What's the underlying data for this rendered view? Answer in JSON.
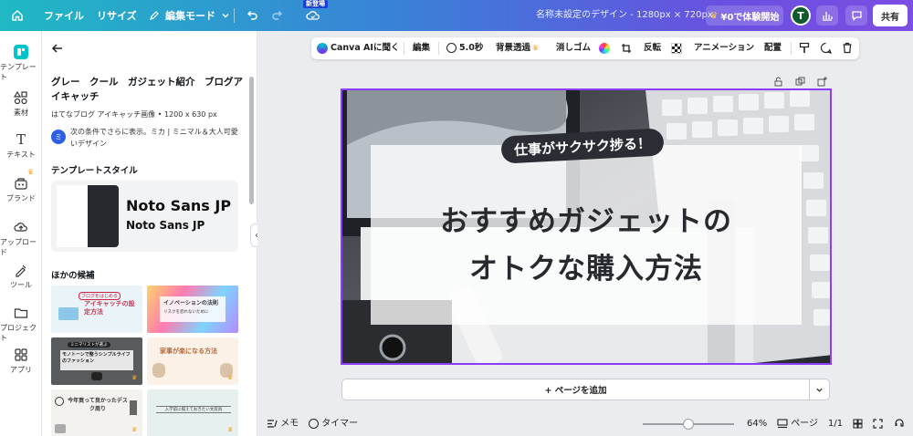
{
  "topbar": {
    "home_icon": "home-icon",
    "file_label": "ファイル",
    "resize_label": "リサイズ",
    "edit_mode_label": "編集モード",
    "new_badge": "新登場",
    "doc_title": "名称未設定のデザイン - 1280px × 720px",
    "trial_label": "¥0で体験開始",
    "avatar_initial": "T",
    "share_label": "共有"
  },
  "rail": {
    "items": [
      {
        "label": "テンプレート",
        "icon": "template-icon"
      },
      {
        "label": "素材",
        "icon": "elements-icon"
      },
      {
        "label": "テキスト",
        "icon": "text-icon"
      },
      {
        "label": "ブランド",
        "icon": "brand-icon"
      },
      {
        "label": "アップロード",
        "icon": "upload-icon"
      },
      {
        "label": "ツール",
        "icon": "tools-icon"
      },
      {
        "label": "プロジェクト",
        "icon": "folder-icon"
      },
      {
        "label": "アプリ",
        "icon": "apps-icon"
      }
    ]
  },
  "panel": {
    "template_title": "グレー　クール　ガジェット紹介　ブログアイキャッチ",
    "template_meta": "はてなブログ アイキャッチ画像 • 1200 x 630 px",
    "author_initials": "ミ",
    "author_text": "次の条件でさらに表示。ミカ | ミニマル＆大人可愛いデザイン",
    "style_heading": "テンプレートスタイル",
    "font_name_1": "Noto Sans JP",
    "font_name_2": "Noto Sans JP",
    "others_heading": "ほかの候補",
    "thumbs": [
      {
        "top": "ブログをはじめる",
        "main": "アイキャッチの設定方法"
      },
      {
        "top": "イノベーションの法則",
        "main": "リスクを恐れないために"
      },
      {
        "top": "ミニマリストが選ぶ",
        "main": "モノトーンで整うシンプルライフのファッション"
      },
      {
        "top": "",
        "main": "家事が楽になる方法"
      },
      {
        "top": "",
        "main": "今年買って良かったデスク周り"
      },
      {
        "top": "",
        "main": "入学前に揃えておきたい文房具"
      }
    ]
  },
  "context_bar": {
    "canva_ai": "Canva AIに聞く",
    "edit": "編集",
    "duration": "5.0秒",
    "bg_remove": "背景透過",
    "eraser": "消しゴム",
    "flip": "反転",
    "animation": "アニメーション",
    "position": "配置"
  },
  "design": {
    "badge_text": "仕事がサクサク捗る！",
    "headline_1": "おすすめガジェットの",
    "headline_2": "オトクな購入方法"
  },
  "add_page_label": "+ ページを追加",
  "bottombar": {
    "notes_label": "メモ",
    "timer_label": "タイマー",
    "zoom": "64%",
    "page_label": "ページ",
    "page_count": "1/1"
  },
  "colors": {
    "accent": "#8b3dff",
    "topbar_start": "#1fb9c4",
    "topbar_end": "#7c4ee4"
  }
}
